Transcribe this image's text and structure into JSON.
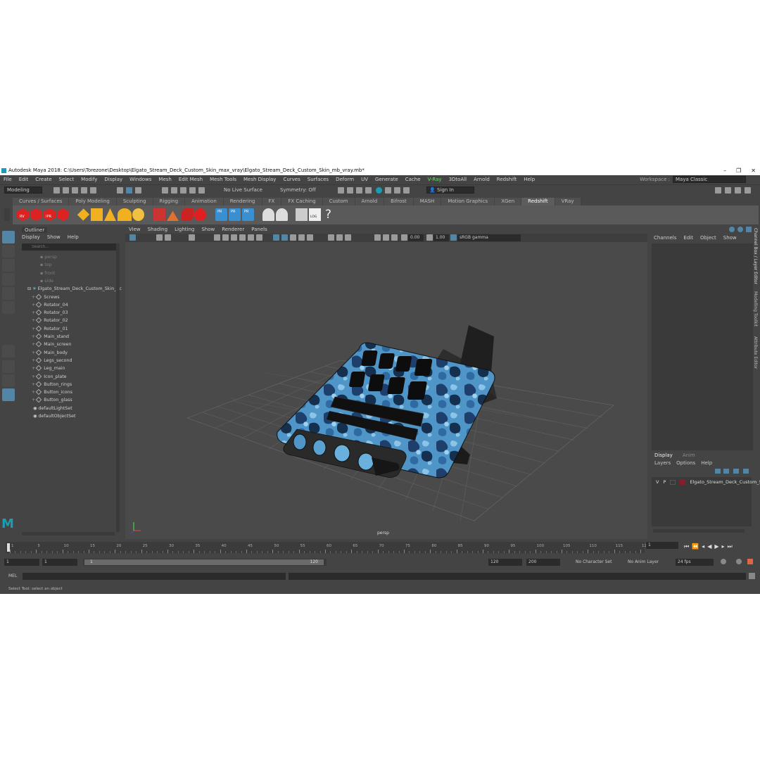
{
  "window": {
    "title": "Autodesk Maya 2018: C:\\Users\\Torezone\\Desktop\\Elgato_Stream_Deck_Custom_Skin_max_vray\\Elgato_Stream_Deck_Custom_Skin_mb_vray.mb*",
    "minimize": "–",
    "maximize": "❐",
    "close": "✕"
  },
  "menu": [
    "File",
    "Edit",
    "Create",
    "Select",
    "Modify",
    "Display",
    "Windows",
    "Mesh",
    "Edit Mesh",
    "Mesh Tools",
    "Mesh Display",
    "Curves",
    "Surfaces",
    "Deform",
    "UV",
    "Generate",
    "Cache",
    "V-Ray",
    "3DtoAll",
    "Arnold",
    "Redshift",
    "Help"
  ],
  "workspace": {
    "label": "Workspace :",
    "value": "Maya Classic"
  },
  "toolbar": {
    "mode": "Modeling",
    "live_surface": "No Live Surface",
    "symmetry": "Symmetry: Off",
    "sign_in": "Sign In"
  },
  "shelf_tabs": [
    "Curves / Surfaces",
    "Poly Modeling",
    "Sculpting",
    "Rigging",
    "Animation",
    "Rendering",
    "FX",
    "FX Caching",
    "Custom",
    "Arnold",
    "Bifrost",
    "MASH",
    "Motion Graphics",
    "XGen",
    "Redshift",
    "VRay"
  ],
  "shelf_active": "Redshift",
  "shelf_icons": {
    "rv": "RV",
    "ipr": "IPR",
    "pr": "PR",
    "log": "LOG",
    "help": "?"
  },
  "outliner": {
    "title": "Outliner",
    "menu": [
      "Display",
      "Show",
      "Help"
    ],
    "search_placeholder": "Search...",
    "cameras": [
      "persp",
      "top",
      "front",
      "side"
    ],
    "root": "Elgato_Stream_Deck_Custom_Skin_nc",
    "children": [
      "Screws",
      "Rotator_04",
      "Rotator_03",
      "Rotator_02",
      "Rotator_01",
      "Main_stand",
      "Main_screen",
      "Main_body",
      "Legs_second",
      "Leg_main",
      "Icon_plate",
      "Button_rings",
      "Button_icons",
      "Button_glass"
    ],
    "sets": [
      "defaultLightSet",
      "defaultObjectSet"
    ]
  },
  "viewport": {
    "menu": [
      "View",
      "Shading",
      "Lighting",
      "Show",
      "Renderer",
      "Panels"
    ],
    "exposure": "0.00",
    "gamma": "1.00",
    "color_space": "sRGB gamma",
    "camera_label": "persp"
  },
  "channel_box": {
    "menu": [
      "Channels",
      "Edit",
      "Object",
      "Show"
    ],
    "layer_tabs": [
      "Display",
      "Anim"
    ],
    "layer_menu": [
      "Layers",
      "Options",
      "Help"
    ],
    "layer": {
      "v": "V",
      "p": "P",
      "name": "Elgato_Stream_Deck_Custom_S"
    }
  },
  "side_tabs": [
    "Channel Box / Layer Editor",
    "Modelling Toolkit",
    "Attribute Editor"
  ],
  "timeline": {
    "ticks": [
      "1",
      "5",
      "10",
      "15",
      "20",
      "25",
      "30",
      "35",
      "40",
      "45",
      "50",
      "55",
      "60",
      "65",
      "70",
      "75",
      "80",
      "85",
      "90",
      "95",
      "100",
      "105",
      "110",
      "115",
      "120"
    ],
    "current_frame": "1"
  },
  "range": {
    "start": "1",
    "start2": "1",
    "slider_start": "1",
    "slider_end": "120",
    "end": "120",
    "end2": "200",
    "char_set": "No Character Set",
    "anim_layer": "No Anim Layer",
    "fps": "24 fps"
  },
  "mel": {
    "label": "MEL"
  },
  "help_line": "Select Tool: select an object",
  "colors": {
    "accent": "#5285a6",
    "layer_swatch": "#8b1a2a",
    "vray": "#66e066"
  }
}
